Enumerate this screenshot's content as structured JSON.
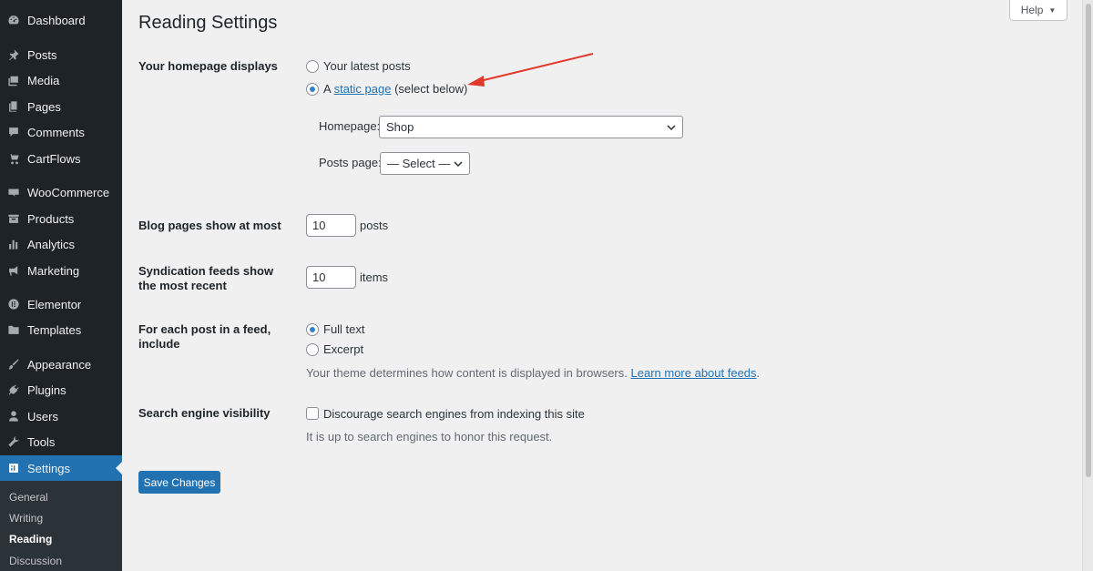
{
  "sidebar": {
    "items": [
      {
        "label": "Dashboard",
        "icon": "dashboard-icon"
      },
      {
        "label": "Posts",
        "icon": "pin-icon"
      },
      {
        "label": "Media",
        "icon": "media-icon"
      },
      {
        "label": "Pages",
        "icon": "pages-icon"
      },
      {
        "label": "Comments",
        "icon": "comment-icon"
      },
      {
        "label": "CartFlows",
        "icon": "cartflows-icon"
      },
      {
        "label": "WooCommerce",
        "icon": "woocommerce-icon"
      },
      {
        "label": "Products",
        "icon": "products-icon"
      },
      {
        "label": "Analytics",
        "icon": "analytics-icon"
      },
      {
        "label": "Marketing",
        "icon": "megaphone-icon"
      },
      {
        "label": "Elementor",
        "icon": "elementor-icon"
      },
      {
        "label": "Templates",
        "icon": "folder-icon"
      },
      {
        "label": "Appearance",
        "icon": "brush-icon"
      },
      {
        "label": "Plugins",
        "icon": "plug-icon"
      },
      {
        "label": "Users",
        "icon": "user-icon"
      },
      {
        "label": "Tools",
        "icon": "wrench-icon"
      },
      {
        "label": "Settings",
        "icon": "settings-icon"
      }
    ],
    "submenu": [
      "General",
      "Writing",
      "Reading",
      "Discussion"
    ],
    "active_submenu": "Reading"
  },
  "header": {
    "help_label": "Help",
    "title": "Reading Settings"
  },
  "form": {
    "homepage_displays": {
      "label": "Your homepage displays",
      "option_latest": "Your latest posts",
      "option_static_prefix": "A",
      "option_static_link": "static page",
      "option_static_suffix": "(select below)",
      "selected": "static"
    },
    "homepage_select": {
      "label": "Homepage:",
      "value": "Shop"
    },
    "posts_page_select": {
      "label": "Posts page:",
      "value": "— Select —"
    },
    "blog_pages": {
      "label": "Blog pages show at most",
      "value": "10",
      "unit": "posts"
    },
    "syndication": {
      "label": "Syndication feeds show the most recent",
      "value": "10",
      "unit": "items"
    },
    "feed_content": {
      "label": "For each post in a feed, include",
      "option_full": "Full text",
      "option_excerpt": "Excerpt",
      "selected": "full",
      "description": "Your theme determines how content is displayed in browsers.",
      "link": "Learn more about feeds",
      "link_suffix": "."
    },
    "search_visibility": {
      "label": "Search engine visibility",
      "checkbox_label": "Discourage search engines from indexing this site",
      "checked": false,
      "description": "It is up to search engines to honor this request."
    },
    "save_label": "Save Changes"
  },
  "colors": {
    "sidebar_bg": "#1d2327",
    "accent": "#2271b1",
    "annotation_arrow": "#e0382b"
  }
}
